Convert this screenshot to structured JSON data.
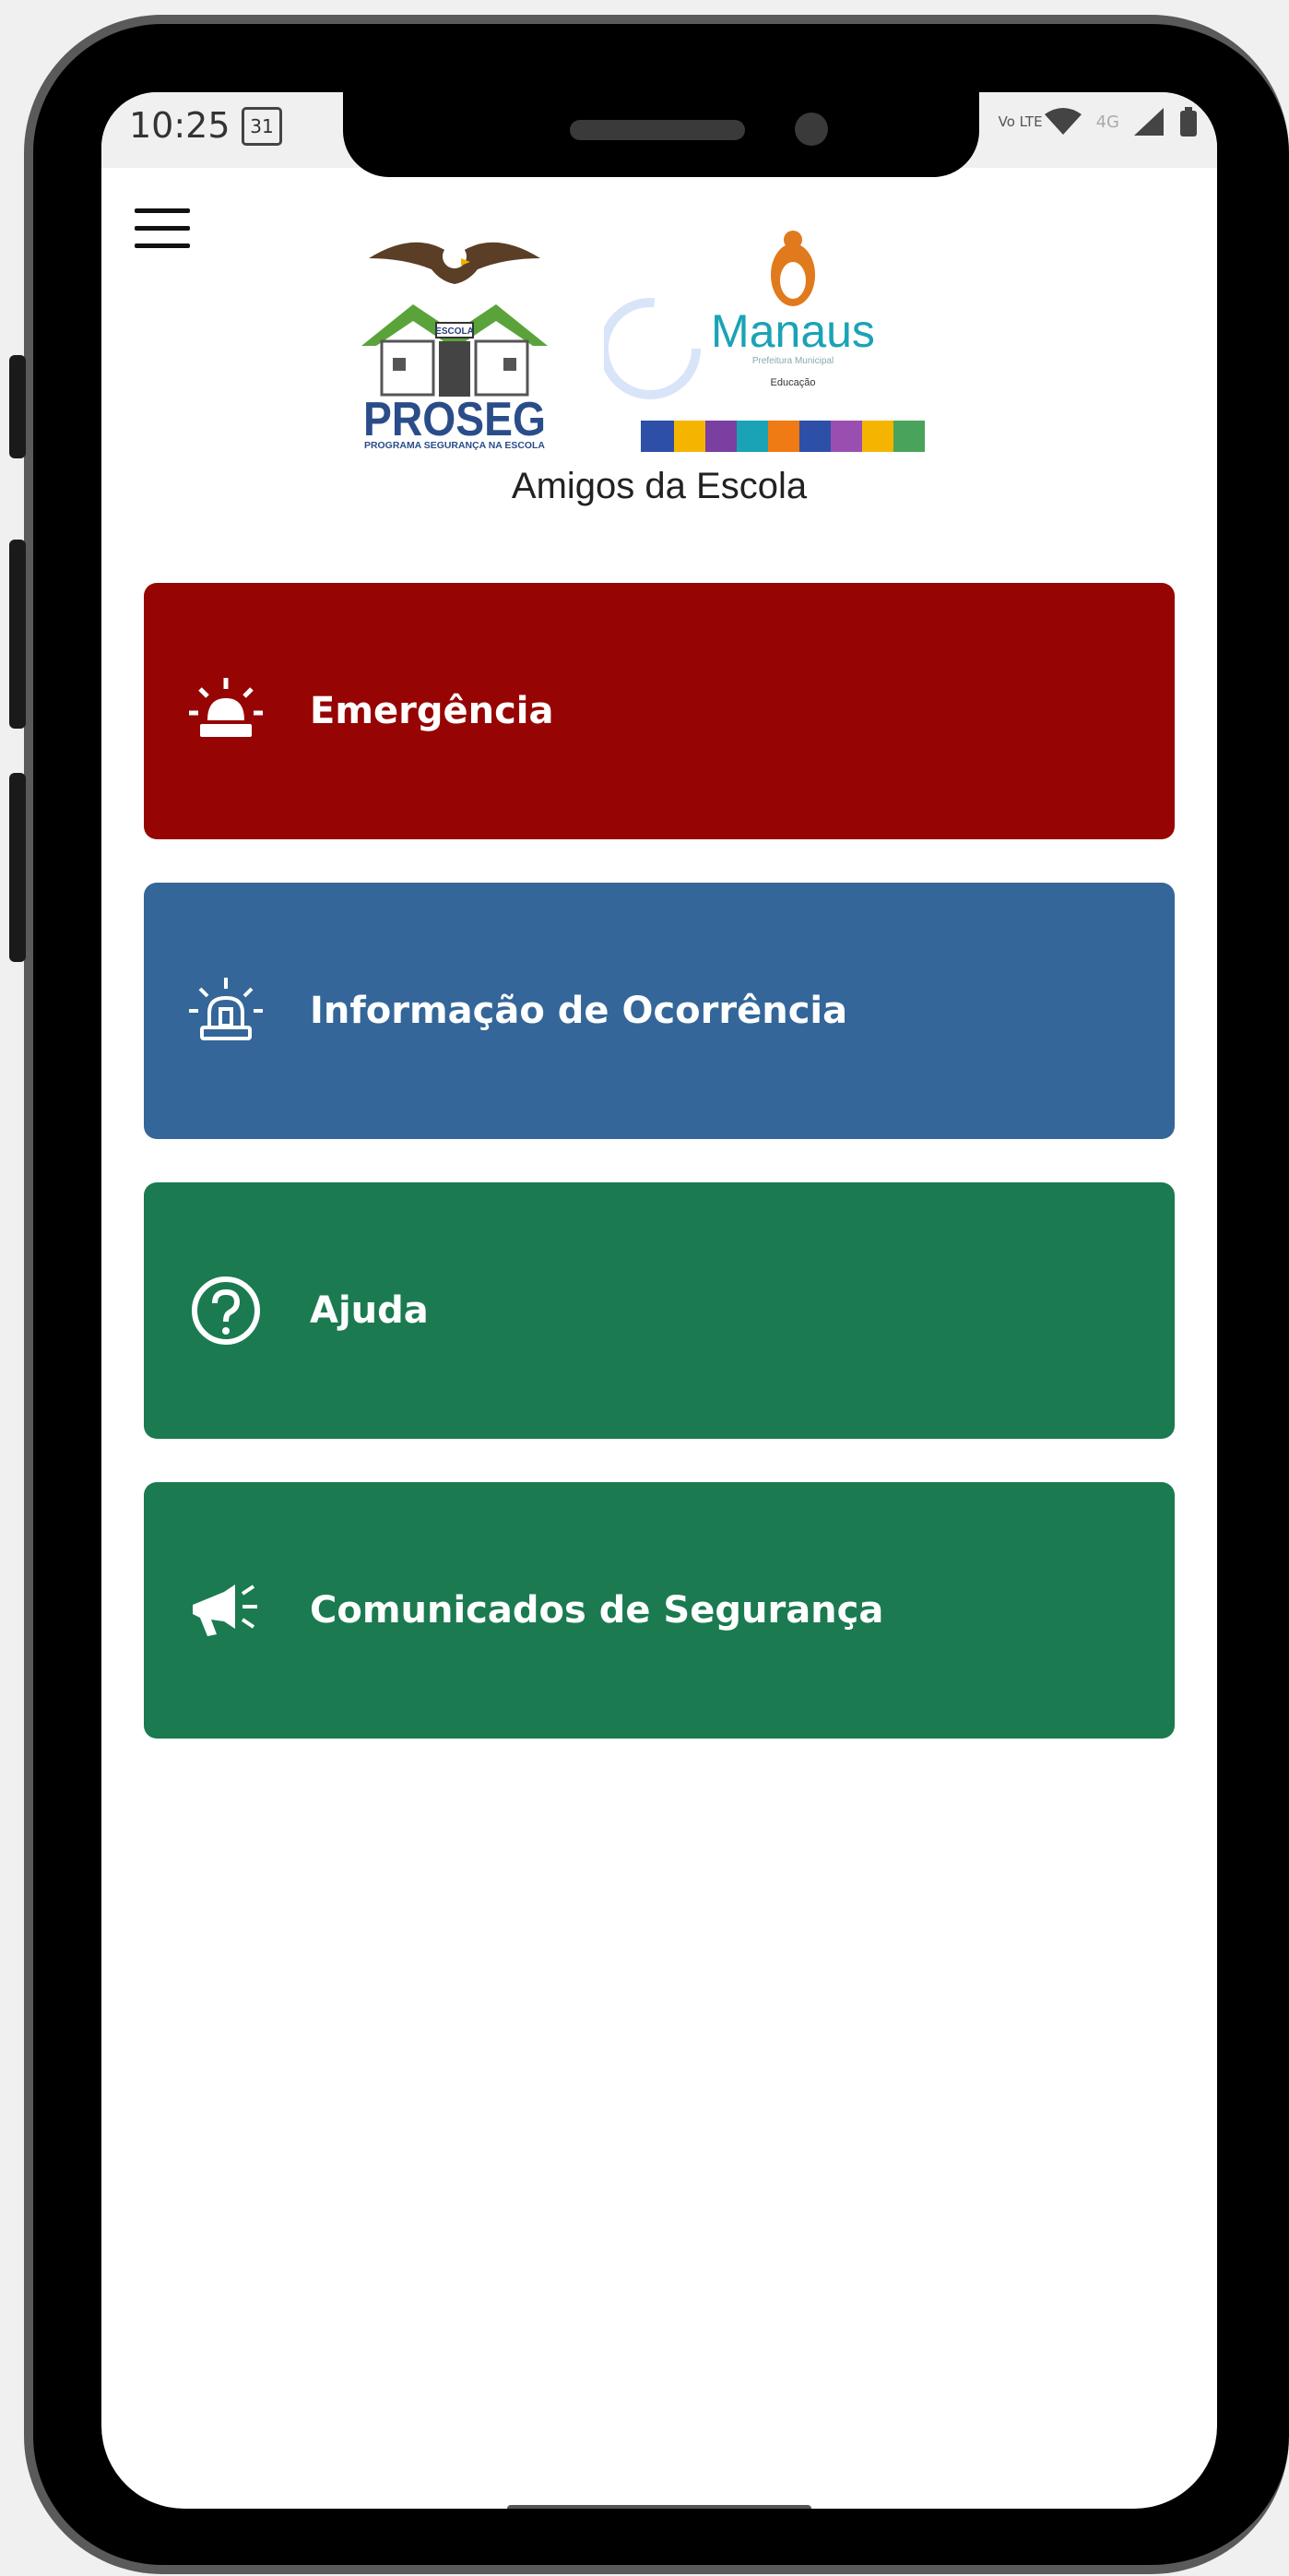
{
  "status_bar": {
    "time": "10:25",
    "calendar_badge": "31",
    "volte": "Vo LTE",
    "network": "4G"
  },
  "header": {
    "proseg_logo": {
      "top_text": "ESCOLA",
      "name": "PROSEG",
      "subtitle": "PROGRAMA SEGURANÇA NA ESCOLA"
    },
    "manaus_logo": {
      "name": "Manaus",
      "tagline": "Prefeitura Municipal",
      "subtitle": "Educação"
    },
    "app_title": "Amigos da Escola"
  },
  "menu": [
    {
      "label": "Emergência",
      "icon": "siren-icon",
      "color": "#970404"
    },
    {
      "label": "Informação de Ocorrência",
      "icon": "siren-outline-icon",
      "color": "#346699"
    },
    {
      "label": "Ajuda",
      "icon": "question-circle-icon",
      "color": "#1b7a50"
    },
    {
      "label": "Comunicados de Segurança",
      "icon": "megaphone-icon",
      "color": "#1b7a50"
    }
  ]
}
